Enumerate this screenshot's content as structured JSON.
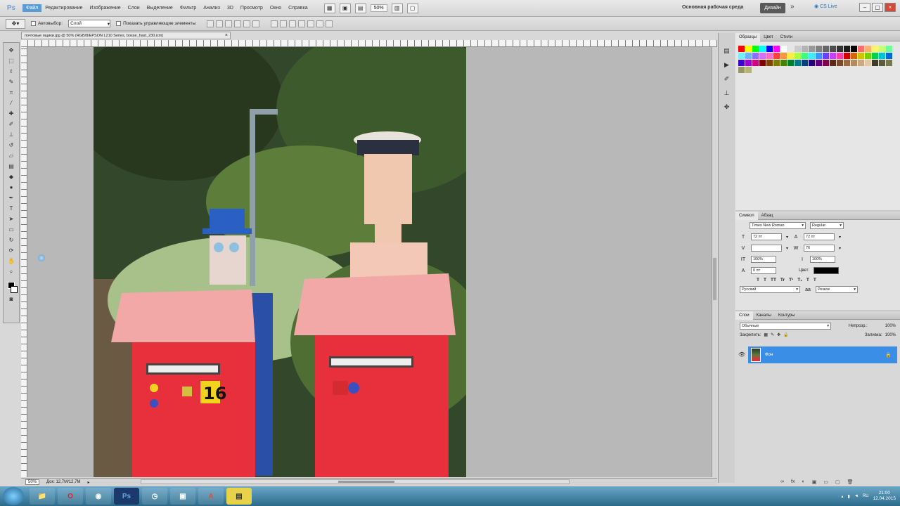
{
  "menubar": {
    "app_logo": "Ps",
    "items": [
      "Файл",
      "Редактирование",
      "Изображение",
      "Слои",
      "Выделение",
      "Фильтр",
      "Анализ",
      "3D",
      "Просмотр",
      "Окно",
      "Справка"
    ],
    "zoom": "50%",
    "workspace": "Основная рабочая среда",
    "design_button": "Дизайн",
    "more": "»",
    "cs_live": "CS Live"
  },
  "optbar": {
    "auto_select_label": "Автовыбор:",
    "auto_select_value": "Слой",
    "transform_label": "Показать управляющие элементы"
  },
  "document": {
    "tab_title": "почтовые ящики.jpg @ 50% (RGB/8/EPSON L210 Series, bosse_hast_230.icm)",
    "close": "×"
  },
  "status": {
    "zoom": "50%",
    "doc_info": "Док: 12,7M/12,7M"
  },
  "swatches_panel": {
    "tabs": [
      "Образцы",
      "Цвет",
      "Стили"
    ],
    "colors": [
      "#ff0000",
      "#ffff00",
      "#00ff00",
      "#00ffff",
      "#0000ff",
      "#ff00ff",
      "#ffffff",
      "#e6e6e6",
      "#cccccc",
      "#b3b3b3",
      "#999999",
      "#808080",
      "#666666",
      "#4d4d4d",
      "#333333",
      "#1a1a1a",
      "#000000",
      "#ff6f6f",
      "#ffb36f",
      "#fff26f",
      "#c8ff6f",
      "#6fff9b",
      "#6ff2ff",
      "#6fb3ff",
      "#8f6fff",
      "#d56fff",
      "#ff6fc8",
      "#ff4040",
      "#ff9640",
      "#ffec40",
      "#a8ff40",
      "#40ff7a",
      "#40ecff",
      "#4096ff",
      "#6a40ff",
      "#c440ff",
      "#ff40a8",
      "#d00000",
      "#d06a00",
      "#d0c400",
      "#7ad000",
      "#00d04a",
      "#00c4d0",
      "#006ad0",
      "#3a00d0",
      "#9a00d0",
      "#d0007a",
      "#800000",
      "#804000",
      "#807a00",
      "#4a8000",
      "#00802c",
      "#007a80",
      "#004080",
      "#240080",
      "#600080",
      "#80004a",
      "#5a2c1a",
      "#7a4a2c",
      "#9a6a44",
      "#b48a60",
      "#cca880",
      "#e2c8a4",
      "#3c3c28",
      "#5a5a3c",
      "#787850",
      "#969664",
      "#b4b478"
    ],
    "rows": 3
  },
  "character_panel": {
    "tabs": [
      "Символ",
      "Абзац"
    ],
    "font_family": "Times New Roman",
    "font_style": "Regular",
    "size": "72 пт",
    "leading": "72 пт",
    "kerning": "",
    "tracking": "76",
    "vscale": "100%",
    "hscale": "100%",
    "baseline": "0 пт",
    "color_label": "Цвет:",
    "style_buttons": [
      "T",
      "T",
      "TT",
      "Tr",
      "T¹",
      "T₁",
      "T",
      "T"
    ],
    "language": "Русский",
    "antialias": "Резкое"
  },
  "layers_panel": {
    "tabs": [
      "Слои",
      "Каналы",
      "Контуры"
    ],
    "blend_mode": "Обычные",
    "opacity_label": "Непрозр.:",
    "opacity": "100%",
    "lock_label": "Закрепить:",
    "fill_label": "Заливка:",
    "fill": "100%",
    "layer_name": "Фон",
    "footer_icons": [
      "∞",
      "fx",
      "◐",
      "▣",
      "▭",
      "▢",
      "🗑"
    ]
  },
  "taskbar": {
    "apps": [
      "📁",
      "O",
      "◉",
      "Ps",
      "◷",
      "▣",
      "A",
      "▤"
    ],
    "time": "21:00",
    "date": "12.04.2015"
  }
}
